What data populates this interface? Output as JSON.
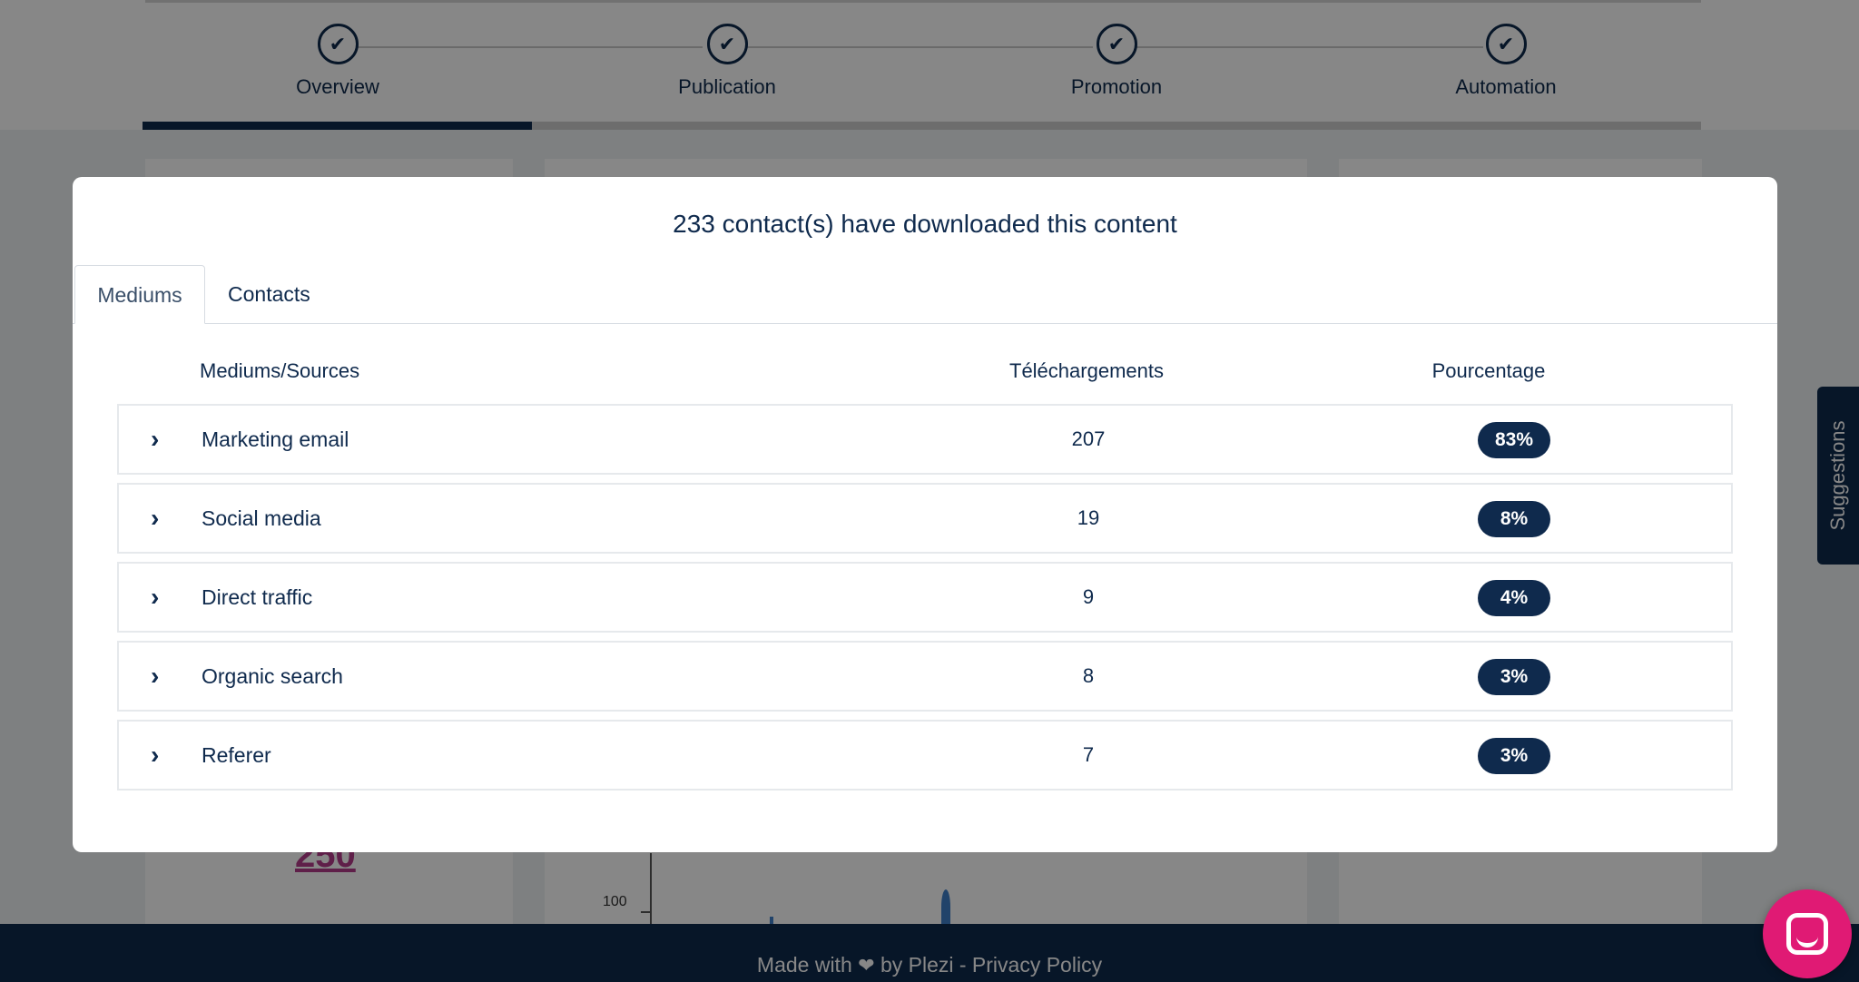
{
  "stepper": {
    "steps": [
      {
        "label": "Overview",
        "done": true
      },
      {
        "label": "Publication",
        "done": true
      },
      {
        "label": "Promotion",
        "done": true
      },
      {
        "label": "Automation",
        "done": true
      }
    ],
    "check_glyph": "✔",
    "progress_fraction": 0.25
  },
  "background": {
    "big_number": "250",
    "chart_axis_label": "100"
  },
  "footer": {
    "made_with": "Made with",
    "heart_icon": "heart-icon",
    "by": "by Plezi - Privacy Policy"
  },
  "suggestions": {
    "label": "Suggestions"
  },
  "modal": {
    "title": "233 contact(s) have downloaded this content",
    "tabs": [
      {
        "label": "Mediums",
        "active": true
      },
      {
        "label": "Contacts",
        "active": false
      }
    ],
    "columns": {
      "source": "Mediums/Sources",
      "downloads": "Téléchargements",
      "percent": "Pourcentage"
    },
    "rows": [
      {
        "label": "Marketing email",
        "count": "207",
        "percent": "83%"
      },
      {
        "label": "Social media",
        "count": "19",
        "percent": "8%"
      },
      {
        "label": "Direct traffic",
        "count": "9",
        "percent": "4%"
      },
      {
        "label": "Organic search",
        "count": "8",
        "percent": "3%"
      },
      {
        "label": "Referer",
        "count": "7",
        "percent": "3%"
      }
    ],
    "expand_glyph": "›"
  },
  "colors": {
    "navy": "#0f2a4d",
    "chat_pink": "#e01a74",
    "overlay": "rgba(0,0,0,0.47)"
  },
  "chat": {
    "icon": "chat-bubble-icon"
  }
}
